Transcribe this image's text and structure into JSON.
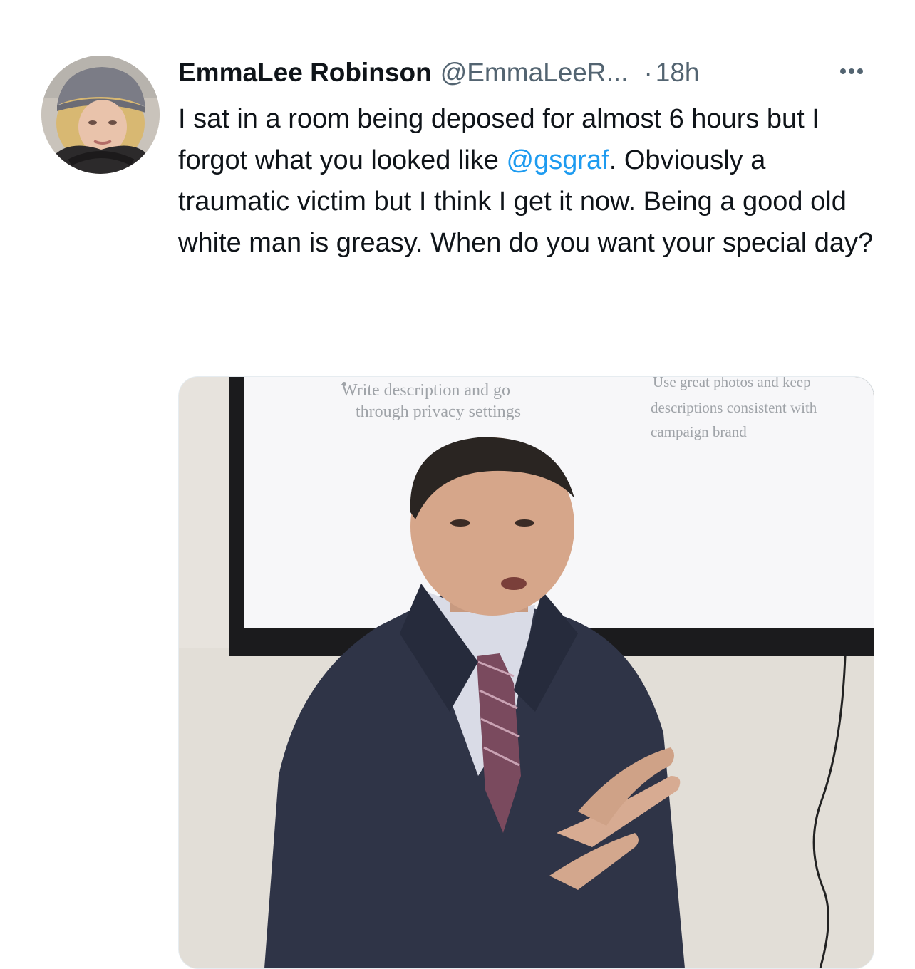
{
  "tweet": {
    "author": {
      "display_name": "EmmaLee Robinson",
      "handle": "@EmmaLeeR...",
      "avatar_icon": "profile-photo"
    },
    "separator": "·",
    "timestamp": "18h",
    "more_icon": "more-options-icon",
    "text": {
      "before_mention": "I sat in a room being deposed for almost 6 hours but I forgot what you looked like ",
      "mention": "@gsgraf",
      "after_mention": ". Obviously a traumatic victim but I think I get it now. Being a good old white man is greasy. When do you want your special day?"
    },
    "media": {
      "slide": {
        "bullet_left_line1": "Write description and go",
        "bullet_left_line2": "through privacy settings",
        "bullet_right_line1": "Use great photos and keep",
        "bullet_right_line2": "descriptions consistent with",
        "bullet_right_line3": "campaign brand"
      }
    },
    "colors": {
      "text": "#0f1419",
      "secondary": "#536471",
      "link": "#1d9bf0"
    }
  }
}
